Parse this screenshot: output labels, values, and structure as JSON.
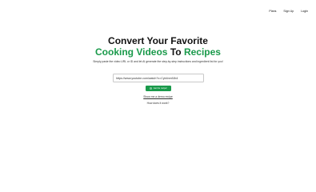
{
  "nav": {
    "items": [
      "Plans",
      "Sign Up",
      "Login"
    ]
  },
  "hero": {
    "title_line1": "Convert Your Favorite",
    "title_line2_part1": "Cooking Videos",
    "title_line2_part2": "To",
    "title_line2_part3": "Recipes",
    "subtitle": "Simply paste the video URL or ID and let AI generate the step-by-step instructions and ingredient list for you!"
  },
  "form": {
    "url_value": "https://www.youtube.com/watch?v=Cyb4nm9Jb4",
    "submit_label": "Get the recipe!",
    "submit_icon": "recipe-icon"
  },
  "links": {
    "demo": "Show me a demo recipe",
    "how": "How does it work?"
  },
  "colors": {
    "accent": "#1a9a4b"
  }
}
